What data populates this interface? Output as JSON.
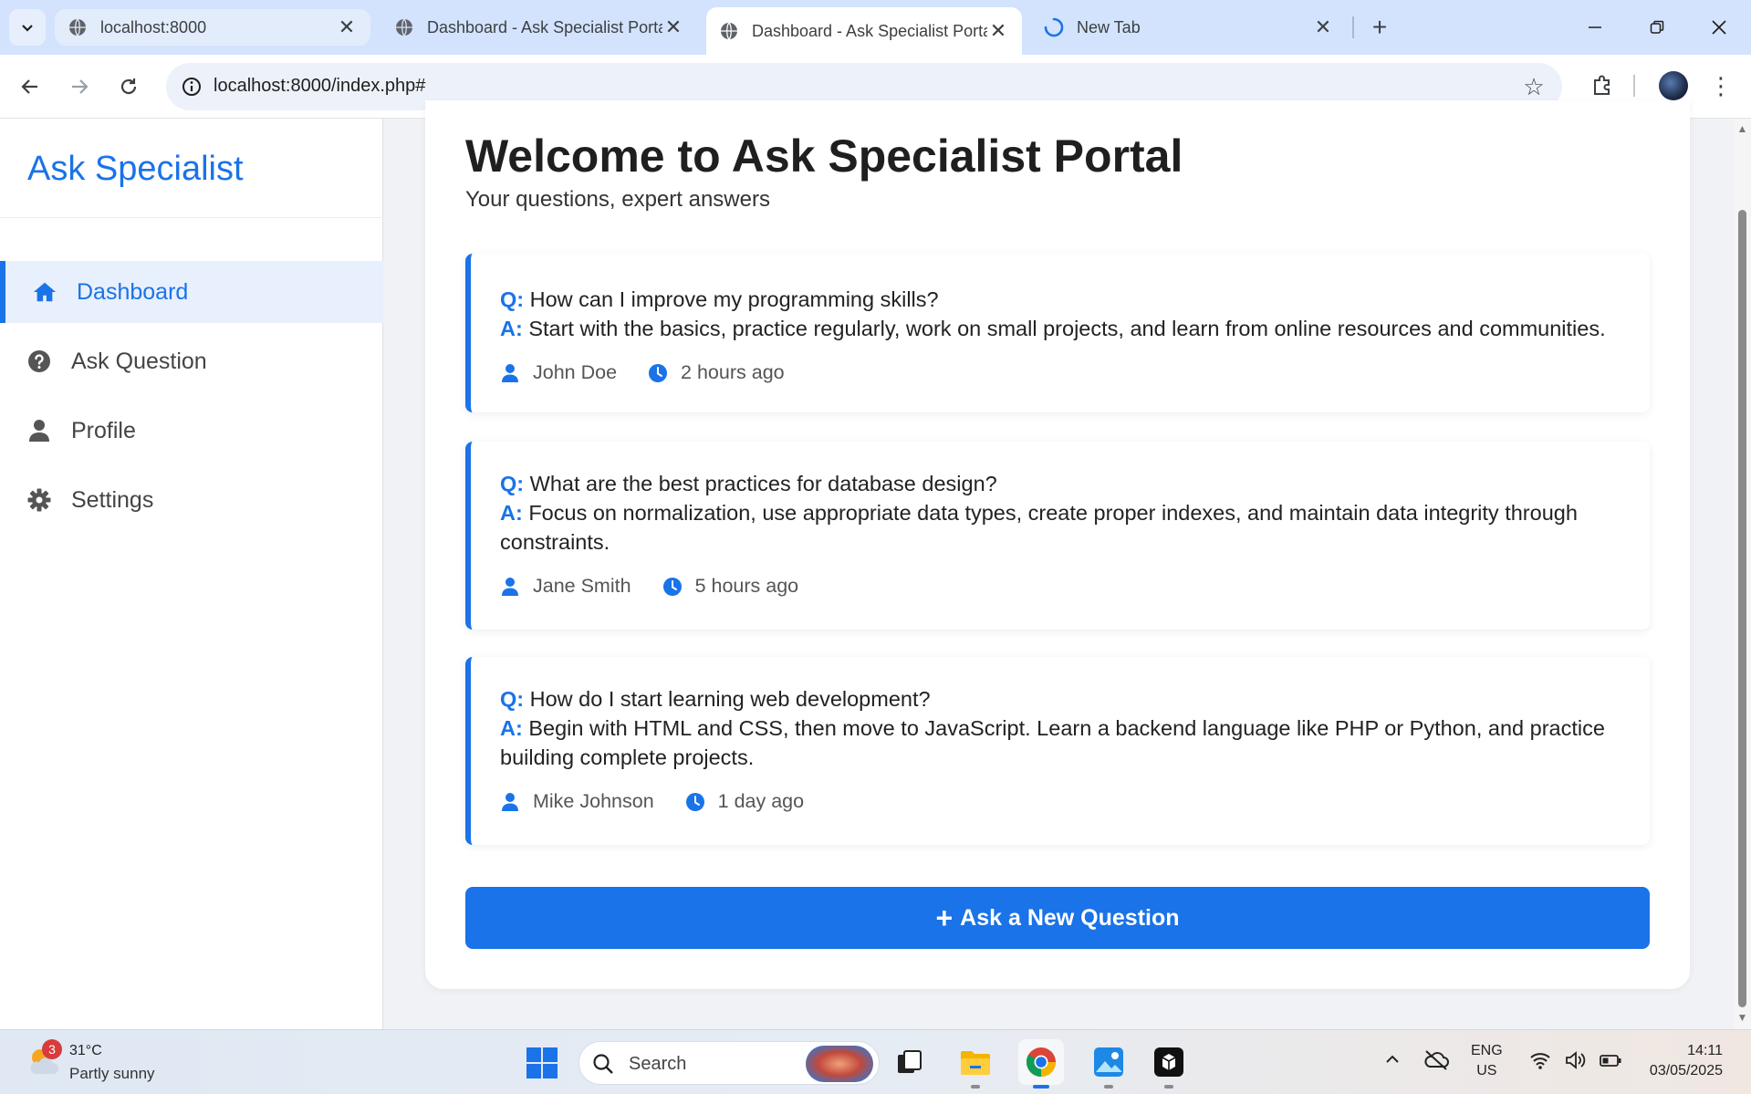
{
  "browser": {
    "tabs": [
      {
        "title": "localhost:8000",
        "state": "inactive"
      },
      {
        "title": "Dashboard - Ask Specialist Portal",
        "state": "inactive"
      },
      {
        "title": "Dashboard - Ask Specialist Portal",
        "state": "active"
      },
      {
        "title": "New Tab",
        "state": "loading"
      }
    ],
    "url": "localhost:8000/index.php#"
  },
  "sidebar": {
    "brand": "Ask Specialist",
    "items": [
      {
        "label": "Dashboard",
        "icon": "home-icon",
        "active": true
      },
      {
        "label": "Ask Question",
        "icon": "question-circle-icon",
        "active": false
      },
      {
        "label": "Profile",
        "icon": "user-icon",
        "active": false
      },
      {
        "label": "Settings",
        "icon": "gear-icon",
        "active": false
      }
    ]
  },
  "main": {
    "title": "Welcome to Ask Specialist Portal",
    "subtitle": "Your questions, expert answers",
    "q_label": "Q:",
    "a_label": "A:",
    "questions": [
      {
        "question": "How can I improve my programming skills?",
        "answer": "Start with the basics, practice regularly, work on small projects, and learn from online resources and communities.",
        "author": "John Doe",
        "time": "2 hours ago"
      },
      {
        "question": "What are the best practices for database design?",
        "answer": "Focus on normalization, use appropriate data types, create proper indexes, and maintain data integrity through constraints.",
        "author": "Jane Smith",
        "time": "5 hours ago"
      },
      {
        "question": "How do I start learning web development?",
        "answer": "Begin with HTML and CSS, then move to JavaScript. Learn a backend language like PHP or Python, and practice building complete projects.",
        "author": "Mike Johnson",
        "time": "1 day ago"
      }
    ],
    "ask_button": {
      "plus": "+",
      "label": "Ask a New Question"
    }
  },
  "colors": {
    "accent": "#1a73e8",
    "active_bg": "#e8f0fe"
  },
  "taskbar": {
    "weather": {
      "badge": "3",
      "temp": "31°C",
      "desc": "Partly sunny"
    },
    "search_placeholder": "Search",
    "apps": [
      "task-view-icon",
      "file-explorer-icon",
      "chrome-icon",
      "photos-icon",
      "terminal-app-icon"
    ],
    "lang_line1": "ENG",
    "lang_line2": "US",
    "time": "14:11",
    "date": "03/05/2025"
  }
}
